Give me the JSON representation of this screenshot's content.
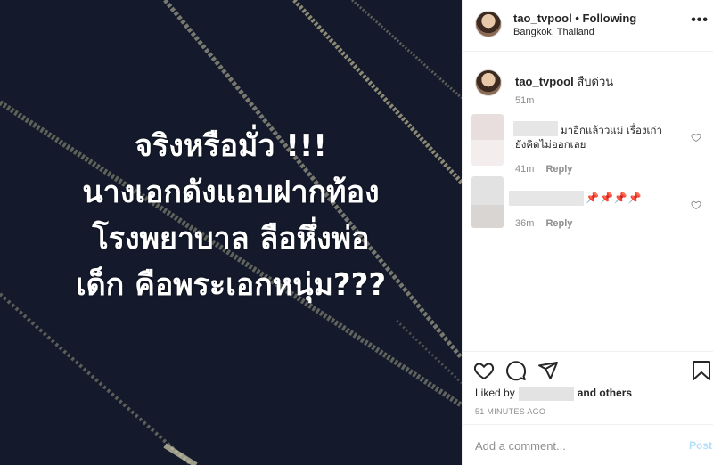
{
  "post_image": {
    "caption_lines": [
      "จริงหรือมั่ว !!!",
      "นางเอกดังแอบฝากท้อง",
      "โรงพยาบาล ลือหึ่งพ่อ",
      "เด็ก คือพระเอกหนุ่ม???"
    ]
  },
  "header": {
    "username": "tao_tvpool",
    "separator": "•",
    "follow_status": "Following",
    "location": "Bangkok, Thailand",
    "more_icon": "more-dots-icon"
  },
  "caption": {
    "username": "tao_tvpool",
    "text": "สืบด่วน",
    "time": "51m"
  },
  "comments": [
    {
      "text_line1": "มาอีกแล้ววแม่ เรื่องเก่า",
      "text_line2": "ยังคิดไม่ออกเลย",
      "time": "41m",
      "reply": "Reply"
    },
    {
      "text": "📌📌📌📌",
      "time": "36m",
      "reply": "Reply"
    }
  ],
  "actions": {
    "icons": [
      "heart-icon",
      "comment-icon",
      "share-icon",
      "bookmark-icon"
    ],
    "liked_prefix": "Liked by",
    "liked_suffix": "and others",
    "time_ago": "51 MINUTES AGO"
  },
  "add_comment": {
    "placeholder": "Add a comment...",
    "post_label": "Post",
    "post_color": "#b2dffc"
  }
}
